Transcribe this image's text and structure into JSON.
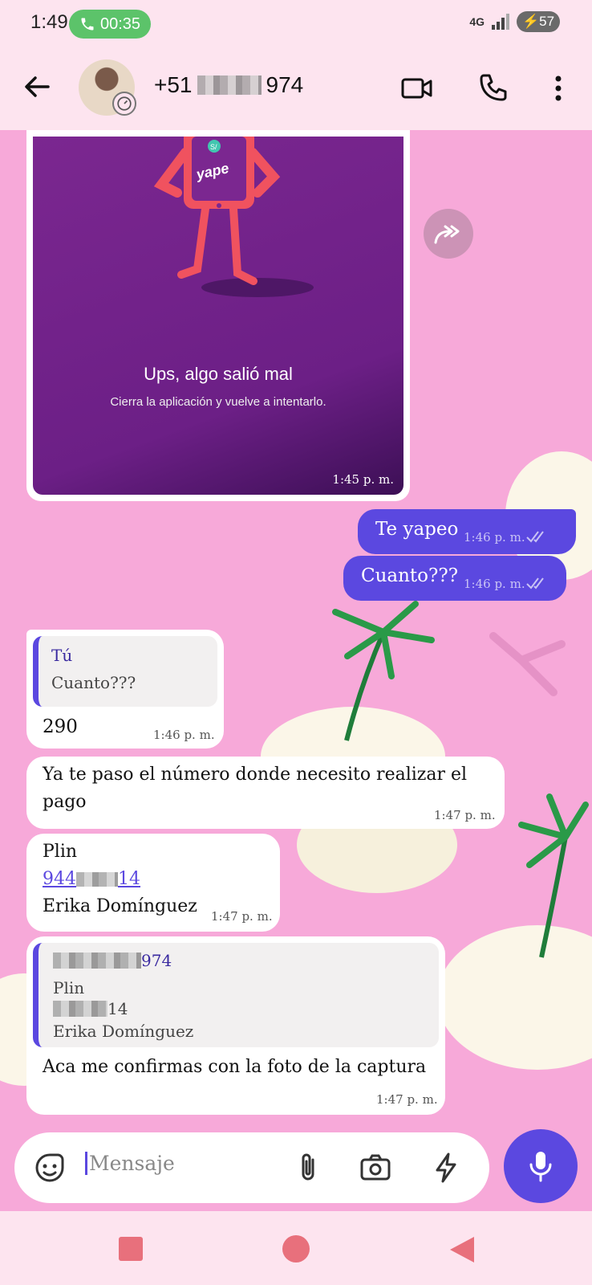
{
  "status_bar": {
    "time": "1:49",
    "call_timer": "00:35",
    "network": "4G",
    "battery": "57"
  },
  "header": {
    "contact_prefix": "+51",
    "contact_suffix": "974"
  },
  "image_message": {
    "title": "Ups, algo salió mal",
    "subtitle": "Cierra la aplicación y vuelve a intentarlo.",
    "time": "1:45 p. m.",
    "brand_badge": "S/",
    "brand": "yape"
  },
  "messages": [
    {
      "text": "Te yapeo",
      "time": "1:46 p. m."
    },
    {
      "text": "Cuanto???",
      "time": "1:46 p. m."
    },
    {
      "quote_author": "Tú",
      "quote_text": "Cuanto???",
      "text": "290",
      "time": "1:46 p. m."
    },
    {
      "text_line1": "Ya te paso el número donde necesito realizar el",
      "text_line2": "pago",
      "time": "1:47 p. m."
    },
    {
      "line1": "Plin",
      "link_prefix": "944",
      "link_suffix": "14",
      "line3": "Erika Domínguez",
      "time": "1:47 p. m."
    },
    {
      "quote_author_suffix": "974",
      "quote_line1": "Plin",
      "quote_line2_suffix": "14",
      "quote_line3": "Erika Domínguez",
      "text": "Aca me confirmas con la foto de la captura",
      "time": "1:47 p. m."
    }
  ],
  "input": {
    "placeholder": "Mensaje"
  },
  "colors": {
    "accent": "#5b48e0",
    "chat_bg": "#f7a9d9",
    "bar_bg": "#fde4ef",
    "call_green": "#5cc36a",
    "yape_purple": "#6c1f86"
  }
}
